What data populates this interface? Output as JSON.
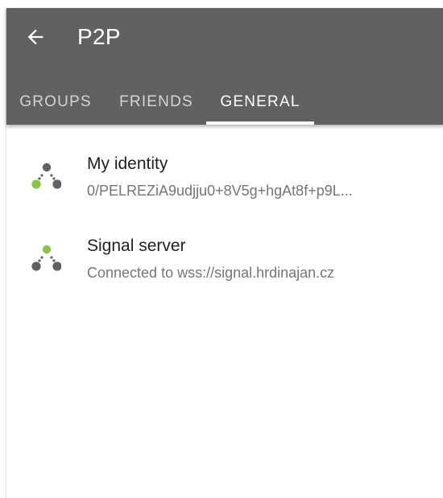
{
  "app": {
    "title": "P2P"
  },
  "tabs": [
    {
      "label": "GROUPS",
      "active": false
    },
    {
      "label": "FRIENDS",
      "active": false
    },
    {
      "label": "GENERAL",
      "active": true
    }
  ],
  "items": [
    {
      "title": "My identity",
      "subtitle": "0/PELREZiA9udjju0+8V5g+hgAt8f+p9L...",
      "icon": "network-identity-icon"
    },
    {
      "title": "Signal server",
      "subtitle": "Connected to wss://signal.hrdinajan.cz",
      "icon": "network-server-icon"
    }
  ],
  "colors": {
    "appbar": "#616161",
    "accent_node": "#8bc34a",
    "node": "#616161"
  }
}
